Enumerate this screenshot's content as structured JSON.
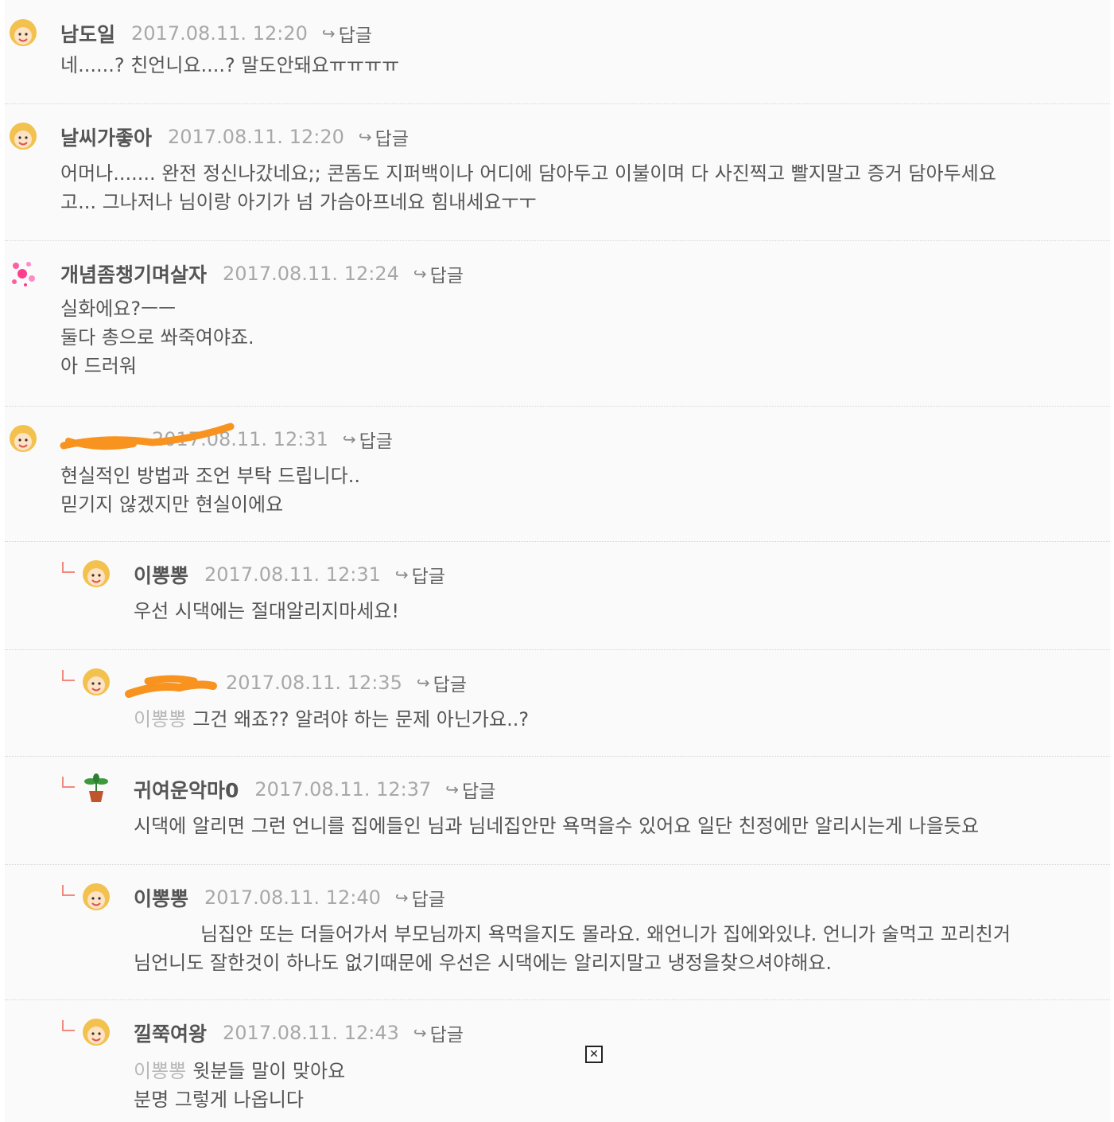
{
  "reply_label": "답글",
  "comments": [
    {
      "nick": "남도일",
      "date": "2017.08.11. 12:20",
      "lines": [
        "네......? 친언니요....? 말도안돼요ㅠㅠㅠㅠ"
      ]
    },
    {
      "nick": "날씨가좋아",
      "date": "2017.08.11. 12:20",
      "lines": [
        "어머나....... 완전 정신나갔네요;; 콘돔도 지퍼백이나 어디에 담아두고 이불이며 다 사진찍고 빨지말고 증거 담아두세요",
        "고... 그나저나 님이랑 아기가 넘 가슴아프네요 힘내세요ㅜㅜ"
      ]
    },
    {
      "nick": "개념좀챙기며살자",
      "date": "2017.08.11. 12:24",
      "lines": [
        "실화에요?ㅡㅡ",
        "둘다 총으로 쏴죽여야죠.",
        "아 드러워"
      ]
    },
    {
      "nick": "",
      "date": "2017.08.11. 12:31",
      "lines": [
        "현실적인 방법과 조언 부탁 드립니다..",
        "믿기지 않겠지만 현실이에요"
      ]
    },
    {
      "nick": "이뽕뽕",
      "date": "2017.08.11. 12:31",
      "lines": [
        "우선 시댁에는 절대알리지마세요!"
      ]
    },
    {
      "nick": "",
      "date": "2017.08.11. 12:35",
      "mention": "이뽕뽕",
      "lines": [
        "그건 왜죠?? 알려야 하는 문제 아닌가요..?"
      ]
    },
    {
      "nick": "귀여운악마0",
      "date": "2017.08.11. 12:37",
      "lines": [
        "시댁에 알리면 그런 언니를 집에들인 님과 님네집안만 욕먹을수 있어요 일단 친정에만 알리시는게 나을듯요"
      ]
    },
    {
      "nick": "이뽕뽕",
      "date": "2017.08.11. 12:40",
      "lines": [
        "님집안 또는 더들어가서 부모님까지 욕먹을지도 몰라요. 왜언니가 집에와있냐. 언니가 술먹고 꼬리친거",
        "님언니도 잘한것이 하나도 없기때문에 우선은 시댁에는 알리지말고 냉정을찾으셔야해요."
      ]
    },
    {
      "nick": "낄쭉여왕",
      "date": "2017.08.11. 12:43",
      "mention": "이뽕뽕",
      "lines": [
        "윗분들 말이 맞아요",
        "분명 그렇게 나옵니다"
      ]
    }
  ],
  "icons": {
    "avatar": "girl-avatar-icon",
    "avatar_alt": "sparkle-avatar-icon",
    "avatar_plant": "plant-avatar-icon",
    "reply": "reply-arrow-icon",
    "close": "close-icon"
  },
  "colors": {
    "reply_mark": "#f08a7e",
    "redaction": "#f7931e",
    "date": "#a8a8a8",
    "mention": "#b8b8b8"
  }
}
